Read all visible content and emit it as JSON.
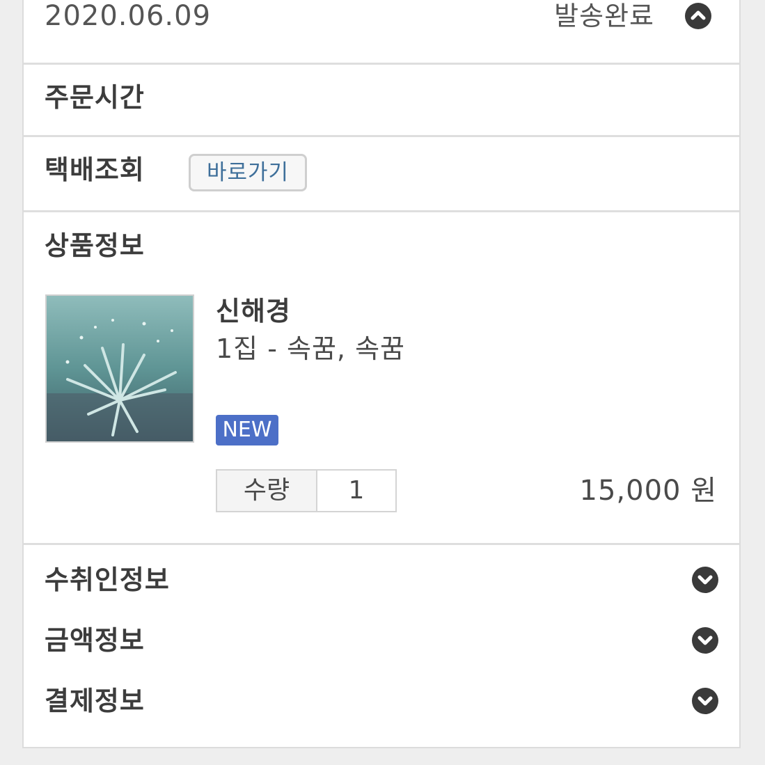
{
  "order": {
    "date": "2020.06.09",
    "status": "발송완료"
  },
  "order_time": {
    "label": "주문시간"
  },
  "tracking": {
    "label": "택배조회",
    "button_label": "바로가기"
  },
  "product_info": {
    "label": "상품정보",
    "name": "신해경",
    "option": "1집 - 속꿈, 속꿈",
    "badge": "NEW",
    "quantity_label": "수량",
    "quantity_value": "1",
    "price": "15,000 원"
  },
  "accordion": {
    "recipient_label": "수취인정보",
    "amount_label": "금액정보",
    "payment_label": "결제정보"
  },
  "icons": {
    "collapse": "chevron-up-circle-icon",
    "expand": "chevron-down-circle-icon"
  },
  "colors": {
    "badge": "#4c6fc7",
    "link": "#3e6f9a",
    "icon": "#3a3a3a"
  }
}
